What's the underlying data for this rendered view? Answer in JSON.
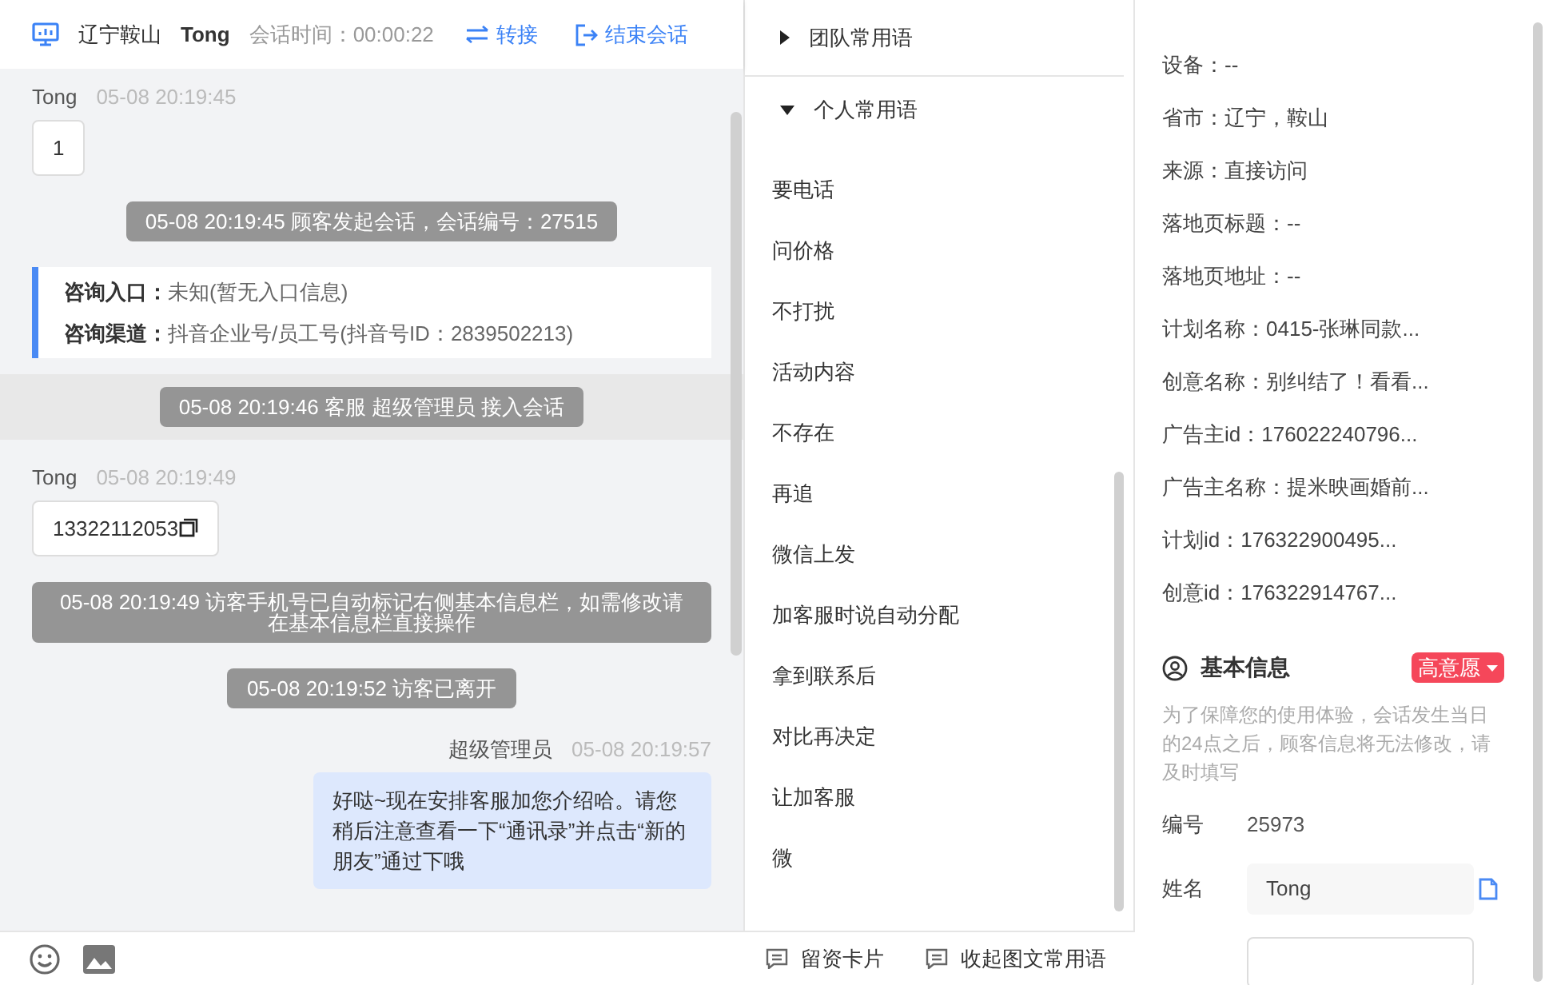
{
  "header": {
    "location": "辽宁鞍山",
    "visitor": "Tong",
    "duration": "会话时间：00:00:22",
    "transfer": "转接",
    "end": "结束会话"
  },
  "messages": [
    {
      "kind": "visitor",
      "sender": "Tong",
      "time": "05-08 20:19:45",
      "text": "1",
      "copyable": false
    },
    {
      "kind": "system",
      "text": "05-08 20:19:45 顾客发起会话，会话编号：27515",
      "band": false
    },
    {
      "kind": "info",
      "rows": [
        {
          "label": "咨询入口：",
          "value": "未知(暂无入口信息)"
        },
        {
          "label": "咨询渠道：",
          "value": "抖音企业号/员工号(抖音号ID：2839502213)"
        }
      ]
    },
    {
      "kind": "system",
      "text": "05-08 20:19:46 客服 超级管理员 接入会话",
      "band": true
    },
    {
      "kind": "visitor",
      "sender": "Tong",
      "time": "05-08 20:19:49",
      "text": "13322112053",
      "copyable": true
    },
    {
      "kind": "system",
      "text": "05-08 20:19:49 访客手机号已自动标记右侧基本信息栏，如需修改请在基本信息栏直接操作",
      "band": false
    },
    {
      "kind": "system",
      "text": "05-08 20:19:52 访客已离开",
      "band": false
    },
    {
      "kind": "agent",
      "sender": "超级管理员",
      "time": "05-08 20:19:57",
      "text": "好哒~现在安排客服加您介绍哈。请您稍后注意查看一下“通讯录”并点击“新的朋友”通过下哦"
    }
  ],
  "phrases": {
    "groups": [
      {
        "title": "团队常用语",
        "expanded": false
      },
      {
        "title": "个人常用语",
        "expanded": true
      }
    ],
    "items": [
      "要电话",
      "问价格",
      "不打扰",
      "活动内容",
      "不存在",
      "再追",
      "微信上发",
      "加客服时说自动分配",
      "拿到联系后",
      "对比再决定",
      "让加客服",
      "微"
    ]
  },
  "footer": {
    "card": "留资卡片",
    "collapse": "收起图文常用语"
  },
  "source_info": [
    "设备：--",
    "省市：辽宁，鞍山",
    "来源：直接访问",
    "落地页标题：--",
    "落地页地址：--",
    "计划名称：0415-张琳同款...",
    "创意名称：别纠结了！看看...",
    "广告主id：176022240796...",
    "广告主名称：提米映画婚前...",
    "计划id：176322900495...",
    "创意id：176322914767..."
  ],
  "basic_info": {
    "title": "基本信息",
    "tag": "高意愿",
    "notice": "为了保障您的使用体验，会话发生当日的24点之后，顾客信息将无法修改，请及时填写",
    "fields": [
      {
        "kind": "text",
        "label": "编号",
        "value": "25973"
      },
      {
        "kind": "input",
        "label": "姓名",
        "value": "Tong"
      }
    ]
  }
}
